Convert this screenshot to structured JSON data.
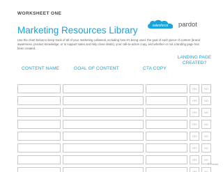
{
  "header": {
    "eyebrow": "WORKSHEET ONE",
    "title": "Marketing Resources Library",
    "intro": "Use the chart below to keep track of all of your marketing collateral, including how it's being used, the goal of each piece of content (brand awareness, product knowledge, or to support sales and help close deals), your call-to-action copy, and whether or not a landing page has been created."
  },
  "logo": {
    "cloud_text": "salesforce",
    "product": "pardot",
    "accent": "#1aa4dc"
  },
  "columns": {
    "content_name": "CONTENT NAME",
    "goal": "GOAL OF CONTENT",
    "cta": "CTA COPY",
    "landing": "LANDING PAGE CREATED?"
  },
  "choice": {
    "yes": "YES",
    "no": "NO"
  },
  "row_count": 8,
  "footer": "© Pardot"
}
